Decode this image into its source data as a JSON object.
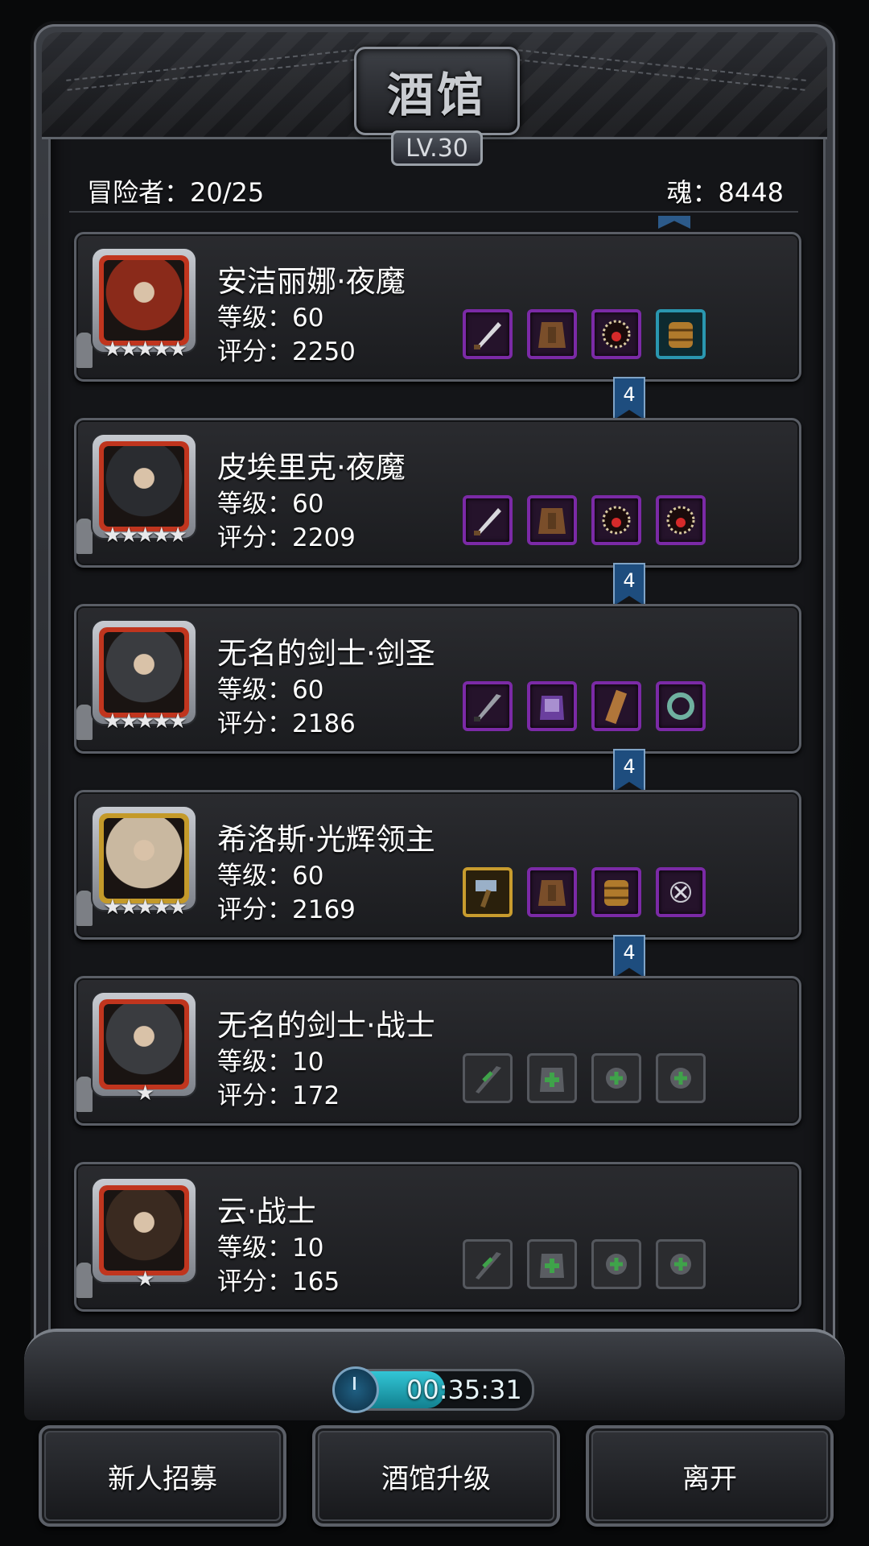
{
  "header": {
    "title": "酒馆",
    "level": "LV.30"
  },
  "stats": {
    "adventurers": "冒险者：20/25",
    "souls": "魂：8448"
  },
  "heroes": [
    {
      "name": "安洁丽娜·夜魔",
      "level": "等级：60",
      "score": "评分：2250",
      "stars": "★★★★★",
      "frame": "red",
      "ribbon": "4",
      "equipment": [
        "purple-dagger-icon",
        "purple-leather-armor-icon",
        "purple-amulet-icon",
        "cyan-wooden-shield-icon"
      ]
    },
    {
      "name": "皮埃里克·夜魔",
      "level": "等级：60",
      "score": "评分：2209",
      "stars": "★★★★★",
      "frame": "red",
      "ribbon": "4",
      "equipment": [
        "purple-dagger-icon",
        "purple-leather-armor-icon",
        "purple-amulet-icon",
        "purple-amulet-icon"
      ]
    },
    {
      "name": "无名的剑士·剑圣",
      "level": "等级：60",
      "score": "评分：2186",
      "stars": "★★★★★",
      "frame": "red",
      "ribbon": "4",
      "equipment": [
        "purple-sword-icon",
        "purple-plate-armor-icon",
        "purple-wooden-plank-icon",
        "purple-ring-icon"
      ]
    },
    {
      "name": "希洛斯·光辉领主",
      "level": "等级：60",
      "score": "评分：2169",
      "stars": "★★★★★",
      "frame": "gold",
      "ribbon": "4",
      "equipment": [
        "gold-hammer-icon",
        "purple-leather-armor-icon",
        "purple-wooden-shield-icon",
        "purple-cross-necklace-icon"
      ]
    },
    {
      "name": "无名的剑士·战士",
      "level": "等级：10",
      "score": "评分：172",
      "stars": "★",
      "frame": "red",
      "ribbon": "",
      "equipment": [
        "empty-weapon-slot-icon",
        "empty-armor-slot-icon",
        "empty-accessory-slot-icon",
        "empty-accessory-slot-icon"
      ]
    },
    {
      "name": "云·战士",
      "level": "等级：10",
      "score": "评分：165",
      "stars": "★",
      "frame": "red",
      "ribbon": "",
      "equipment": [
        "empty-weapon-slot-icon",
        "empty-armor-slot-icon",
        "empty-accessory-slot-icon",
        "empty-accessory-slot-icon"
      ]
    }
  ],
  "timer": {
    "text": "00:35:31",
    "progress": 0.55
  },
  "buttons": {
    "recruit": "新人招募",
    "upgrade": "酒馆升级",
    "leave": "离开"
  },
  "colors": {
    "epic": "#7b2aa6",
    "legendary": "#c89c2e",
    "rare": "#2a97b0",
    "portrait_red": "#c0351e",
    "portrait_gold": "#c49a2a",
    "ribbon": "#1e4d7e"
  }
}
